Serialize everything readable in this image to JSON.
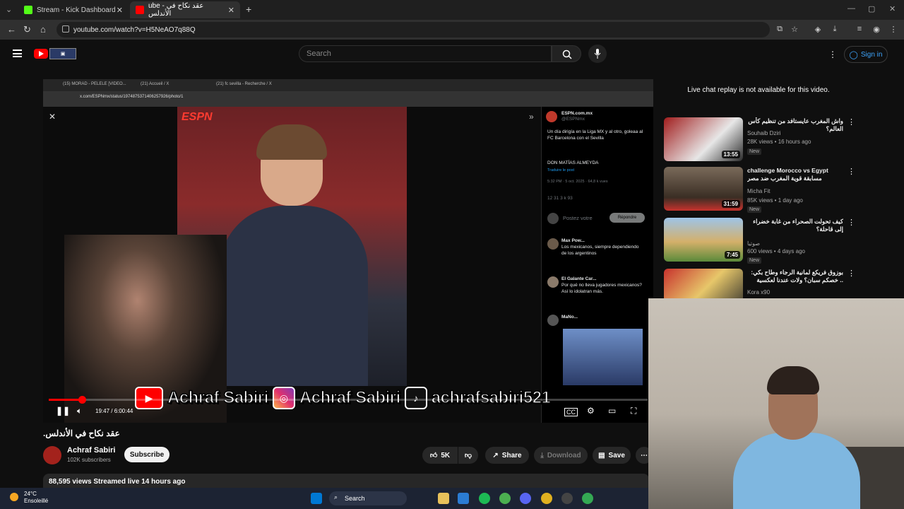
{
  "browser": {
    "tabs": [
      {
        "title": "Stream - Kick Dashboard",
        "color": "#53fc18"
      },
      {
        "title": "ube - عقد نكاح في الأندلس",
        "color": "#ff0000"
      }
    ],
    "url": "youtube.com/watch?v=H5NeAO7q88Q"
  },
  "header": {
    "search_placeholder": "Search",
    "signin_label": "Sign in"
  },
  "player": {
    "inner_tabs": [
      "(15) MORAD - PELELE [VIDEO...",
      "(21) Accueil / X",
      "(21) fc sevilla - Recherche / X"
    ],
    "inner_url": "x.com/ESPNmx/status/1974875371406257926/photo/1",
    "espn_logo": "ESPN",
    "tweet": {
      "account": "ESPN.com.mx",
      "handle": "@ESPNmx",
      "text": "Un día dirigía en la Liga MX y al otro, goleaa al FC Barcelona con el Sevilla",
      "text2": "DON MATÍAS ALMEYDA",
      "translate": "Traduire le post",
      "meta": "5:32 PM · 5 oct. 2025 · 64,8 k vues",
      "stats": "12   31   3 k   93",
      "reply_placeholder": "Postez votre",
      "reply_button": "Répondre",
      "reply1_name": "Max Pow...",
      "reply1_text": "Los mexicanos, siempre dependiendo de los argentinos",
      "reply2_name": "El Galante Car...",
      "reply2_text": "Por qué no lleva jugadores mexicanos? Así lo idolatran más.",
      "reply3_name": "MaNo..."
    },
    "overlay": {
      "youtube": "Achraf Sabiri",
      "instagram": "Achraf Sabiri",
      "tiktok": "achrafsabiri521"
    },
    "progress": 0.055,
    "timecode": "19:47 / 6:00:44"
  },
  "video": {
    "title": ".عقد نكاح في الأندلس",
    "channel": "Achraf Sabiri",
    "subscribers": "102K subscribers",
    "subscribe_label": "Subscribe",
    "likes": "5K",
    "share_label": "Share",
    "download_label": "Download",
    "save_label": "Save",
    "views_line": "88,595 views  Streamed live 14 hours ago"
  },
  "sidebar": {
    "chat_message": "Live chat replay is not available for this video.",
    "recommendations": [
      {
        "title": "واش المغرب عايستافد من تنظيم كأس العالم؟",
        "channel": "Souhaib Dziri",
        "meta": "28K views • 16 hours ago",
        "badge": "New",
        "duration": "13:55",
        "thumb_color": "#a11d1d"
      },
      {
        "title": "challenge Morocco vs Egypt  مسابقة قوية المغرب ضد مصر",
        "channel": "Micha Fit",
        "meta": "85K views • 1 day ago",
        "badge": "New",
        "duration": "31:59",
        "thumb_color": "#5a4a3a"
      },
      {
        "title": "كيف تحولت الصحراء من غابة خضراء إلى قاحلة؟",
        "channel": "صوتيا",
        "meta": "600 views • 4 days ago",
        "badge": "New",
        "duration": "7:45",
        "thumb_color": "#5b8a3a"
      },
      {
        "title": "بوزوق فريكع لمانية الرجاء وطاح بكي: .. خصكم سبان؟ ولات عندنا لعكسية فالرجاء؟",
        "channel": "Kora x90",
        "meta": "",
        "badge": "",
        "duration": "",
        "thumb_color": "#c8322d"
      }
    ]
  },
  "taskbar": {
    "temp": "24°C",
    "condition": "Ensoleillé",
    "search_label": "Search"
  }
}
